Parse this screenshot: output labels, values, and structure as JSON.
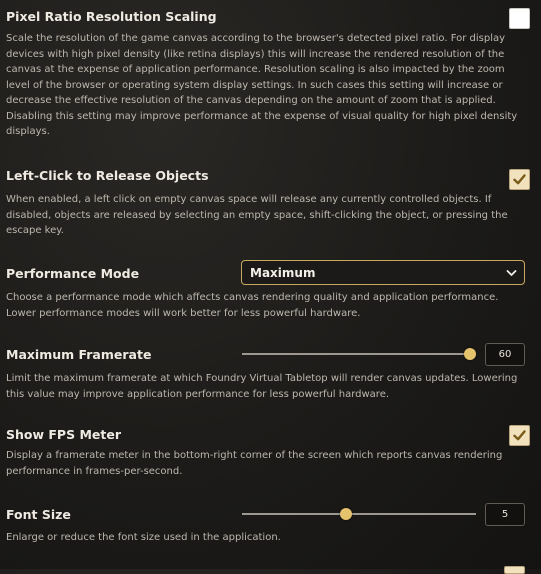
{
  "settings": [
    {
      "label": "Pixel Ratio Resolution Scaling",
      "hint": "Scale the resolution of the game canvas according to the browser's detected pixel ratio. For display devices with high pixel density (like retina displays) this will increase the rendered resolution of the canvas at the expense of application performance. Resolution scaling is also impacted by the zoom level of the browser or operating system display settings. In such cases this setting will increase or decrease the effective resolution of the canvas depending on the amount of zoom that is applied. Disabling this setting may improve performance at the expense of visual quality for high pixel density displays.",
      "checked": false
    },
    {
      "label": "Left-Click to Release Objects",
      "hint": "When enabled, a left click on empty canvas space will release any currently controlled objects. If disabled, objects are released by selecting an empty space, shift-clicking the object, or pressing the escape key.",
      "checked": true
    },
    {
      "label": "Performance Mode",
      "hint": "Choose a performance mode which affects canvas rendering quality and application performance. Lower performance modes will work better for less powerful hardware.",
      "selected": "Maximum"
    },
    {
      "label": "Maximum Framerate",
      "hint": "Limit the maximum framerate at which Foundry Virtual Tabletop will render canvas updates. Lowering this value may improve application performance for less powerful hardware.",
      "value": "60",
      "fraction": 1.0
    },
    {
      "label": "Show FPS Meter",
      "hint": "Display a framerate meter in the bottom-right corner of the screen which reports canvas rendering performance in frames-per-second.",
      "checked": true
    },
    {
      "label": "Font Size",
      "hint": "Enlarge or reduce the font size used in the application.",
      "value": "5",
      "fraction": 0.44
    }
  ],
  "colors": {
    "accent": "#e5c36d",
    "check_bg": "#f1e2bd",
    "select_border": "#c9a95c"
  },
  "icons": {
    "check": "checkmark-icon",
    "chevron": "chevron-down-icon"
  }
}
